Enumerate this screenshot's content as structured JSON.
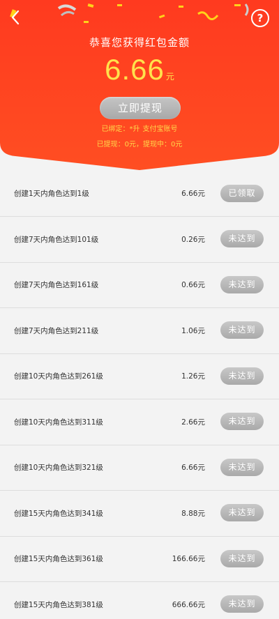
{
  "header": {
    "title": "恭喜您获得红包金额",
    "amount": "6.66",
    "amount_unit": "元",
    "withdraw_button": "立即提现",
    "bound_prefix": "已绑定：",
    "bound_name": "*升",
    "bound_account": "支付宝账号",
    "withdraw_status": "已提现：0元，提现中：0元",
    "colors": {
      "top": "#ff3a1f",
      "bottom": "#ff4d22",
      "accent": "#ffe24c"
    }
  },
  "icons": {
    "back": "chevron-left-icon",
    "help": "help-icon"
  },
  "tasks": [
    {
      "label": "创建1天内角色达到1级",
      "reward": "6.66元",
      "status": "已领取"
    },
    {
      "label": "创建7天内角色达到101级",
      "reward": "0.26元",
      "status": "未达到"
    },
    {
      "label": "创建7天内角色达到161级",
      "reward": "0.66元",
      "status": "未达到"
    },
    {
      "label": "创建7天内角色达到211级",
      "reward": "1.06元",
      "status": "未达到"
    },
    {
      "label": "创建10天内角色达到261级",
      "reward": "1.26元",
      "status": "未达到"
    },
    {
      "label": "创建10天内角色达到311级",
      "reward": "2.66元",
      "status": "未达到"
    },
    {
      "label": "创建10天内角色达到321级",
      "reward": "6.66元",
      "status": "未达到"
    },
    {
      "label": "创建15天内角色达到341级",
      "reward": "8.88元",
      "status": "未达到"
    },
    {
      "label": "创建15天内角色达到361级",
      "reward": "166.66元",
      "status": "未达到"
    },
    {
      "label": "创建15天内角色达到381级",
      "reward": "666.66元",
      "status": "未达到"
    }
  ]
}
